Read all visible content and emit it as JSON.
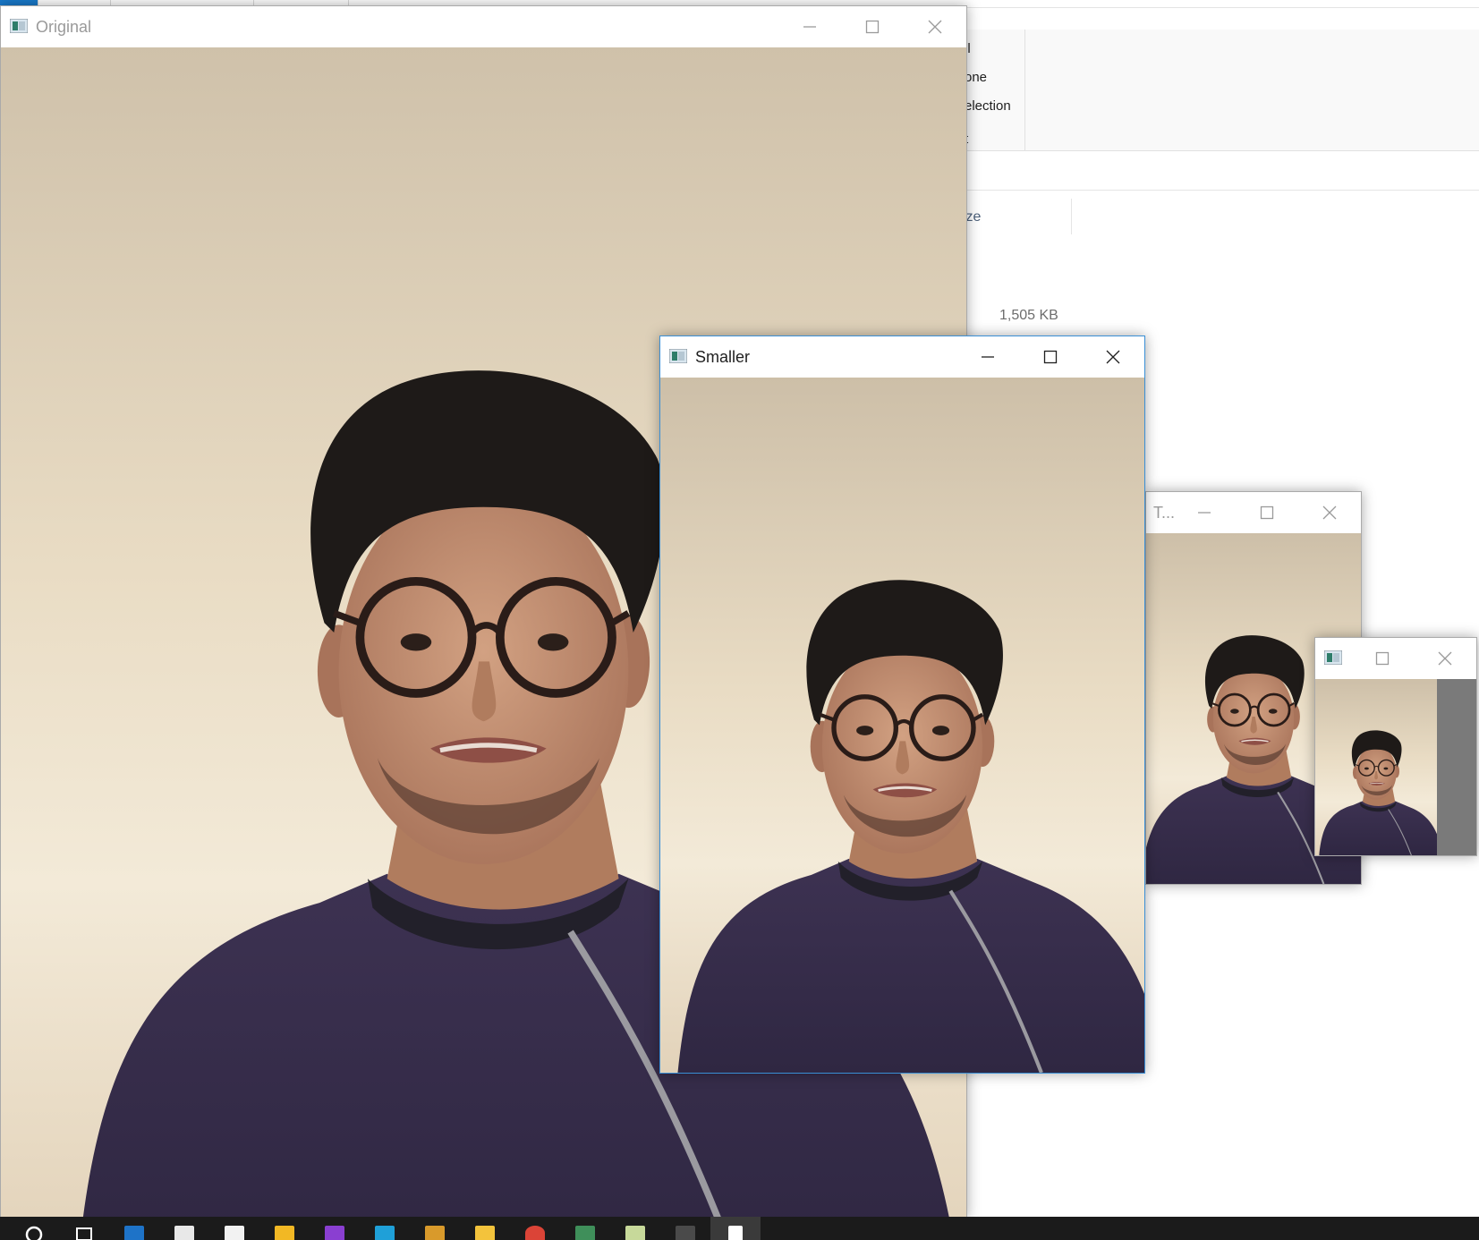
{
  "background_explorer": {
    "ribbon_lines": [
      "ll",
      "one",
      "election",
      "t"
    ],
    "column_header": "ize",
    "file_size": "1,505 KB"
  },
  "windows": {
    "original": {
      "title": "Original"
    },
    "smaller": {
      "title": "Smaller"
    },
    "third": {
      "title": "T..."
    },
    "fourth": {
      "title": ""
    }
  },
  "icons": {
    "window_icon": "window-app-icon",
    "minimize": "minimize-icon",
    "maximize": "maximize-icon",
    "close": "close-icon"
  },
  "taskbar": {
    "items": [
      "search",
      "task-view",
      "edge",
      "store",
      "mail",
      "sticky-notes",
      "phpstorm",
      "webstorm",
      "cs-go",
      "file-explorer",
      "chrome",
      "sourcetree",
      "excel",
      "terminal",
      "notepad"
    ]
  },
  "colors": {
    "shirt": "#3d3252",
    "wall": "#e8d9c0",
    "hair": "#1e1a18",
    "skin": "#c9977a",
    "accent": "#1979ca"
  }
}
